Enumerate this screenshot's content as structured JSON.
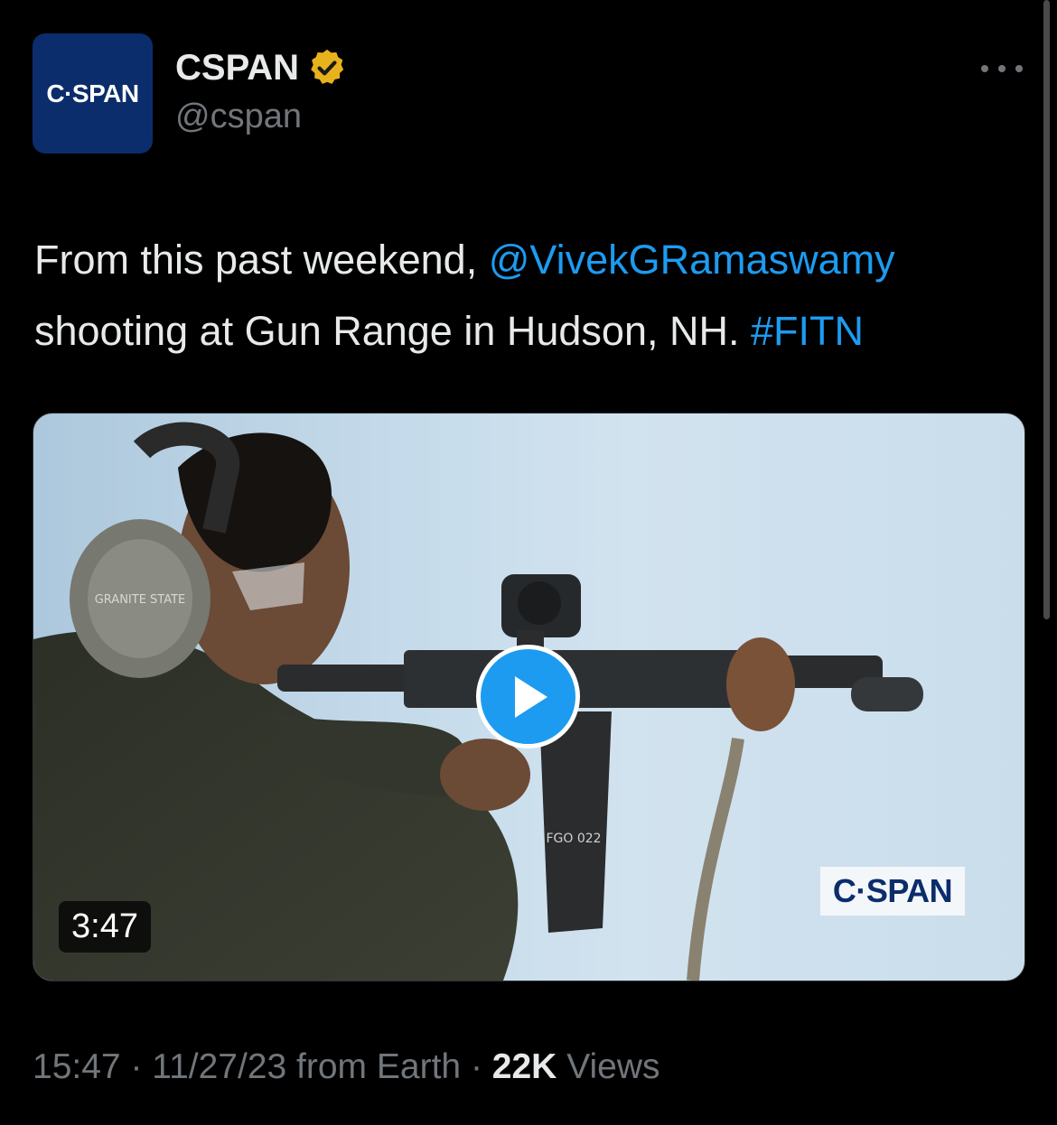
{
  "author": {
    "avatar_text": "C·SPAN",
    "display_name": "CSPAN",
    "handle": "@cspan"
  },
  "tweet": {
    "text_part1": "From this past weekend, ",
    "mention": "@VivekGRamaswamy",
    "text_part2": " shooting at Gun Range in Hudson, NH. ",
    "hashtag": "#FITN"
  },
  "media": {
    "duration": "3:47",
    "watermark": "C·SPAN",
    "earmuff_text": "GRANITE STATE",
    "magazine_text": "FGO 022"
  },
  "meta": {
    "time": "15:47",
    "date_source": "11/27/23 from Earth",
    "views_count": "22K",
    "views_label": "Views",
    "sep": "·"
  },
  "colors": {
    "accent": "#1d9bf0",
    "verified": "#e8b21c",
    "cspan_blue": "#0c2d6b"
  },
  "icons": [
    "verified-badge-icon",
    "more-icon",
    "play-icon"
  ]
}
